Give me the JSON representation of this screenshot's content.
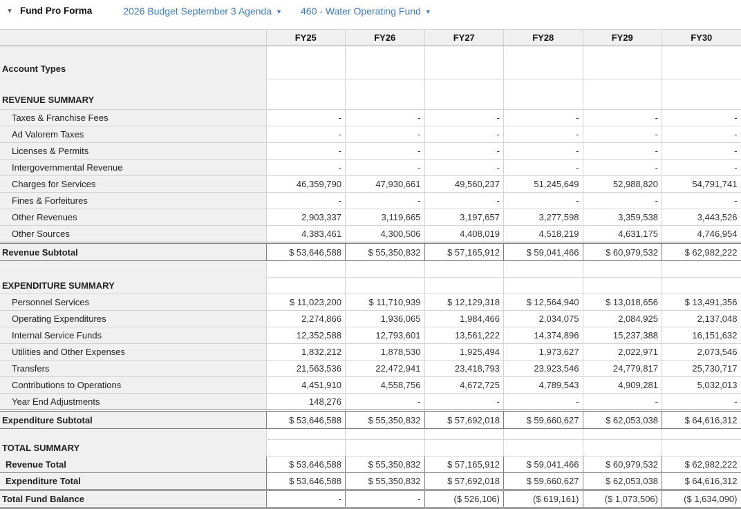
{
  "titlebar": {
    "collapse_caret": "▾",
    "title": "Fund Pro Forma",
    "budget_dropdown": {
      "label": "2026 Budget September 3 Agenda",
      "arrow": "▼"
    },
    "fund_dropdown": {
      "label": "460 - Water Operating Fund",
      "arrow": "▼"
    }
  },
  "colors": {
    "link_blue": "#3E7CBE",
    "header_bg": "#F0F0F0",
    "label_column_bg": "#F0F0F0",
    "border_light": "#D4D4D4",
    "border_dark": "#808080"
  },
  "table": {
    "columns": [
      "FY25",
      "FY26",
      "FY27",
      "FY28",
      "FY29",
      "FY30"
    ],
    "rows": [
      {
        "type": "tall-a",
        "label": "Account Types",
        "values": [
          "",
          "",
          "",
          "",
          "",
          ""
        ]
      },
      {
        "type": "tall-b",
        "label": "REVENUE SUMMARY",
        "values": [
          "",
          "",
          "",
          "",
          "",
          ""
        ]
      },
      {
        "type": "detail",
        "label": "Taxes & Franchise Fees",
        "values": [
          "-",
          "-",
          "-",
          "-",
          "-",
          "-"
        ]
      },
      {
        "type": "detail",
        "label": "Ad Valorem Taxes",
        "values": [
          "-",
          "-",
          "-",
          "-",
          "-",
          "-"
        ]
      },
      {
        "type": "detail",
        "label": "Licenses & Permits",
        "values": [
          "-",
          "-",
          "-",
          "-",
          "-",
          "-"
        ]
      },
      {
        "type": "detail",
        "label": "Intergovernmental Revenue",
        "values": [
          "-",
          "-",
          "-",
          "-",
          "-",
          "-"
        ]
      },
      {
        "type": "detail",
        "label": "Charges for Services",
        "values": [
          "46,359,790",
          "47,930,661",
          "49,560,237",
          "51,245,649",
          "52,988,820",
          "54,791,741"
        ]
      },
      {
        "type": "detail",
        "label": "Fines & Forfeitures",
        "values": [
          "-",
          "-",
          "-",
          "-",
          "-",
          "-"
        ]
      },
      {
        "type": "detail",
        "label": "Other Revenues",
        "values": [
          "2,903,337",
          "3,119,665",
          "3,197,657",
          "3,277,598",
          "3,359,538",
          "3,443,526"
        ]
      },
      {
        "type": "detail",
        "label": "Other Sources",
        "values": [
          "4,383,461",
          "4,300,506",
          "4,408,019",
          "4,518,219",
          "4,631,175",
          "4,746,954"
        ]
      },
      {
        "type": "subtotal",
        "label": "Revenue Subtotal",
        "values": [
          "$ 53,646,588",
          "$ 55,350,832",
          "$ 57,165,912",
          "$ 59,041,466",
          "$ 60,979,532",
          "$ 62,982,222"
        ]
      },
      {
        "type": "spacer",
        "label": "",
        "values": [
          "",
          "",
          "",
          "",
          "",
          ""
        ]
      },
      {
        "type": "section",
        "label": "EXPENDITURE SUMMARY",
        "values": [
          "",
          "",
          "",
          "",
          "",
          ""
        ]
      },
      {
        "type": "detail",
        "label": "Personnel Services",
        "values": [
          "$ 11,023,200",
          "$ 11,710,939",
          "$ 12,129,318",
          "$ 12,564,940",
          "$ 13,018,656",
          "$ 13,491,356"
        ]
      },
      {
        "type": "detail",
        "label": "Operating Expenditures",
        "values": [
          "2,274,866",
          "1,936,065",
          "1,984,466",
          "2,034,075",
          "2,084,925",
          "2,137,048"
        ]
      },
      {
        "type": "detail",
        "label": "Internal Service Funds",
        "values": [
          "12,352,588",
          "12,793,601",
          "13,561,222",
          "14,374,896",
          "15,237,388",
          "16,151,632"
        ]
      },
      {
        "type": "detail",
        "label": "Utilities and Other Expenses",
        "values": [
          "1,832,212",
          "1,878,530",
          "1,925,494",
          "1,973,627",
          "2,022,971",
          "2,073,546"
        ]
      },
      {
        "type": "detail",
        "label": "Transfers",
        "values": [
          "21,563,536",
          "22,472,941",
          "23,418,793",
          "23,923,546",
          "24,779,817",
          "25,730,717"
        ]
      },
      {
        "type": "detail",
        "label": "Contributions to Operations",
        "values": [
          "4,451,910",
          "4,558,756",
          "4,672,725",
          "4,789,543",
          "4,909,281",
          "5,032,013"
        ]
      },
      {
        "type": "detail",
        "label": "Year End Adjustments",
        "values": [
          "148,276",
          "-",
          "-",
          "-",
          "-",
          "-"
        ]
      },
      {
        "type": "subtotal",
        "label": "Expenditure Subtotal",
        "values": [
          "$ 53,646,588",
          "$ 55,350,832",
          "$ 57,692,018",
          "$ 59,660,627",
          "$ 62,053,038",
          "$ 64,616,312"
        ]
      },
      {
        "type": "spacer-sm",
        "label": "",
        "values": [
          "",
          "",
          "",
          "",
          "",
          ""
        ]
      },
      {
        "type": "section",
        "label": "TOTAL SUMMARY",
        "values": [
          "",
          "",
          "",
          "",
          "",
          ""
        ]
      },
      {
        "type": "totalrow",
        "label": "Revenue Total",
        "values": [
          "$ 53,646,588",
          "$ 55,350,832",
          "$ 57,165,912",
          "$ 59,041,466",
          "$ 60,979,532",
          "$ 62,982,222"
        ]
      },
      {
        "type": "totalrow",
        "label": "Expenditure Total",
        "values": [
          "$ 53,646,588",
          "$ 55,350,832",
          "$ 57,692,018",
          "$ 59,660,627",
          "$ 62,053,038",
          "$ 64,616,312"
        ]
      },
      {
        "type": "grand",
        "label": "Total Fund Balance",
        "values": [
          "-",
          "-",
          "($ 526,106)",
          "($ 619,161)",
          "($ 1,073,506)",
          "($ 1,634,090)"
        ]
      }
    ]
  }
}
